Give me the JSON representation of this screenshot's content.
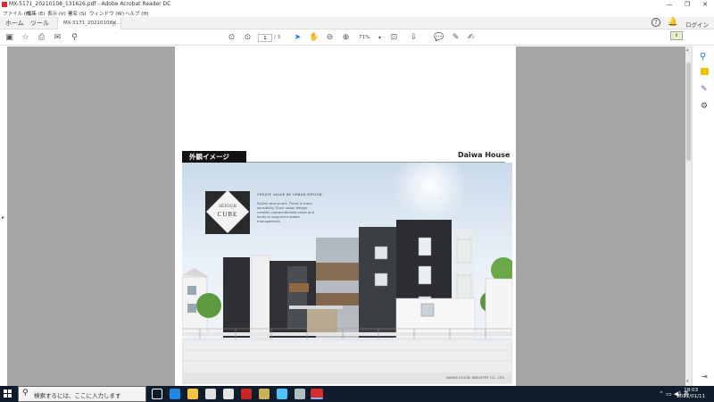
{
  "window": {
    "title": "MX-5171_20210108_131626.pdf - Adobe Acrobat Reader DC",
    "controls": [
      "—",
      "❐",
      "✕"
    ]
  },
  "menu": {
    "items": [
      "ファイル (F)",
      "編集 (E)",
      "表示 (V)",
      "署名 (S)",
      "ウィンドウ (W)",
      "ヘルプ (H)"
    ]
  },
  "tabs": {
    "home": "ホーム",
    "tools": "ツール",
    "document": "MX-5171_20210108_..."
  },
  "header_right": {
    "login": "ログイン"
  },
  "toolbar": {
    "page_current": "1",
    "page_total": "/ 3",
    "zoom": "71%"
  },
  "document": {
    "header_label": "外観イメージ",
    "brand": "Daiwa House",
    "logo_line1": "SÉJOUR",
    "logo_line2": "CUBE",
    "tagline": "CREATE VALUE BY URBAN DESIGN",
    "description": "Stylish and smart. There is more sensibility. Such urban design creates unprecedented value and leads to long-term stable management.",
    "footer": "DAIWA HOUSE INDUSTRY CO., LTD."
  },
  "taskbar": {
    "search_placeholder": "検索するには、ここに入力します",
    "time": "18:03",
    "date": "2021/01/11"
  },
  "colors": {
    "adobe_red": "#d32f2f",
    "taskbar": "#0f1c2c",
    "viewer_bg": "#a6a6a6"
  }
}
